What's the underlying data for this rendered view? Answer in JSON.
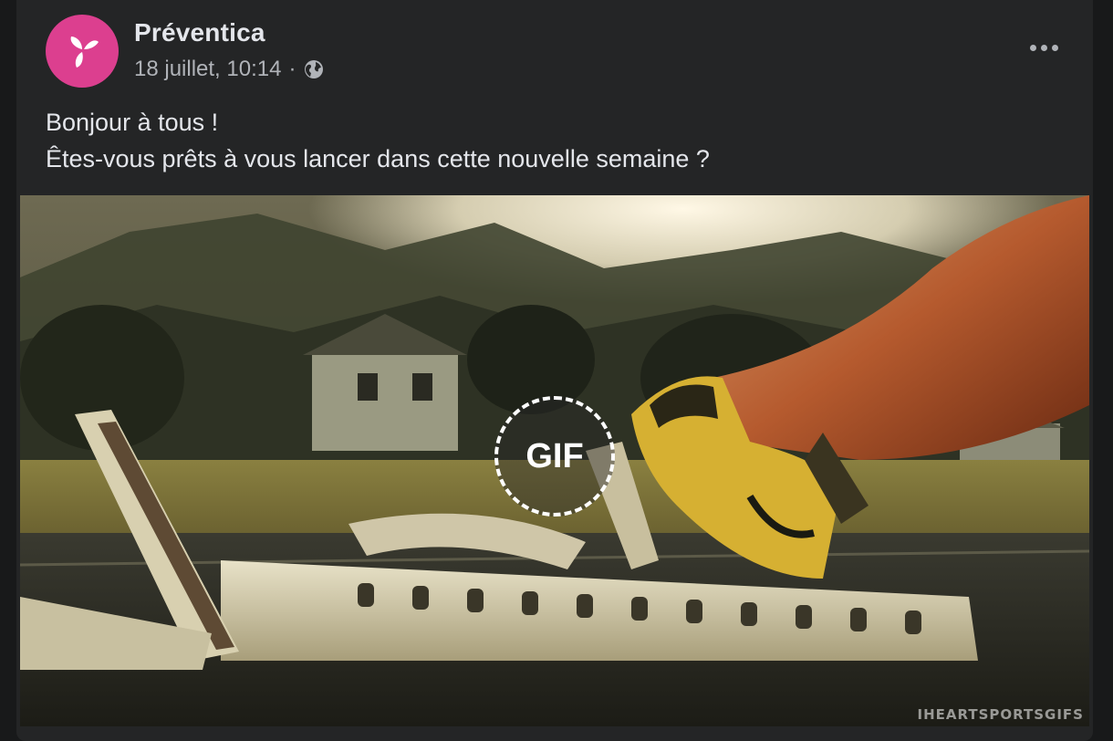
{
  "post": {
    "author": "Préventica",
    "timestamp": "18 juillet, 10:14",
    "separator": "·",
    "audience_icon": "globe-icon",
    "menu_icon": "more-options-icon",
    "text_lines": [
      "Bonjour à tous !",
      "Êtes-vous prêts à vous lancer dans cette nouvelle semaine ?"
    ],
    "media": {
      "badge": "GIF",
      "watermark": "IHEARTSPORTSGIFS"
    }
  },
  "colors": {
    "brand": "#dc3f8f",
    "card": "#242526",
    "text_primary": "#e4e6eb",
    "text_secondary": "#b0b3b8"
  }
}
